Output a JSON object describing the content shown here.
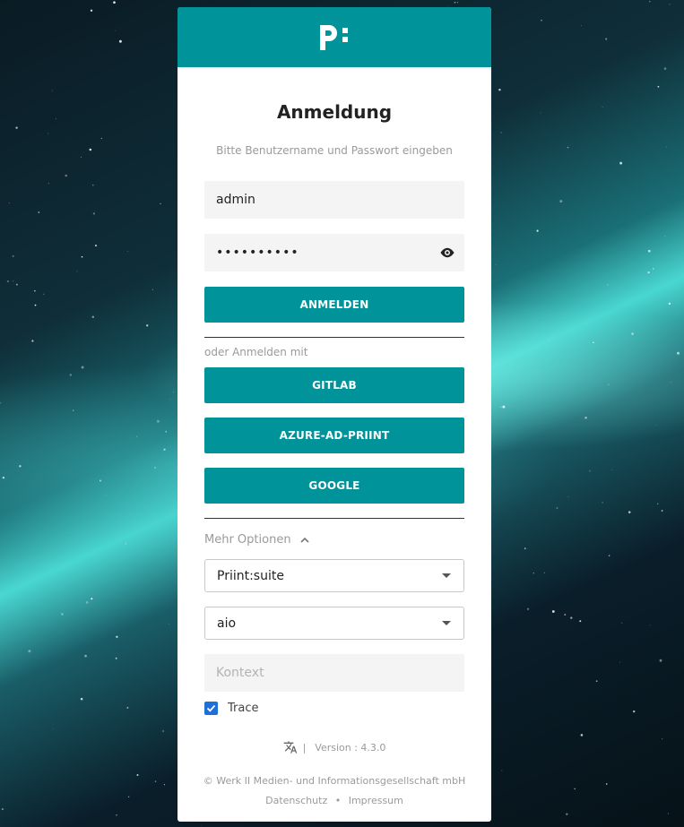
{
  "app": {
    "logo_icon": "priint-logo-icon",
    "accent_color": "#00939a"
  },
  "login": {
    "title": "Anmeldung",
    "subtitle": "Bitte Benutzername und Passwort eingeben",
    "username_value": "admin",
    "password_value": "••••••••••",
    "password_toggle_icon": "eye-icon",
    "submit_label": "ANMELDEN"
  },
  "sso": {
    "label": "oder Anmelden mit",
    "providers": [
      "GITLAB",
      "AZURE-AD-PRIINT",
      "GOOGLE"
    ]
  },
  "options": {
    "toggle_label": "Mehr Optionen",
    "toggle_icon": "chevron-up-icon",
    "select_1_value": "Priint:suite",
    "select_2_value": "aio",
    "context_placeholder": "Kontext",
    "trace_label": "Trace",
    "trace_checked": true
  },
  "footer": {
    "translate_icon": "translate-icon",
    "separator": "|",
    "version": "Version : 4.3.0",
    "copyright": "© Werk II Medien- und Informationsgesellschaft mbH",
    "privacy_link": "Datenschutz",
    "dot": "•",
    "imprint_link": "Impressum"
  }
}
